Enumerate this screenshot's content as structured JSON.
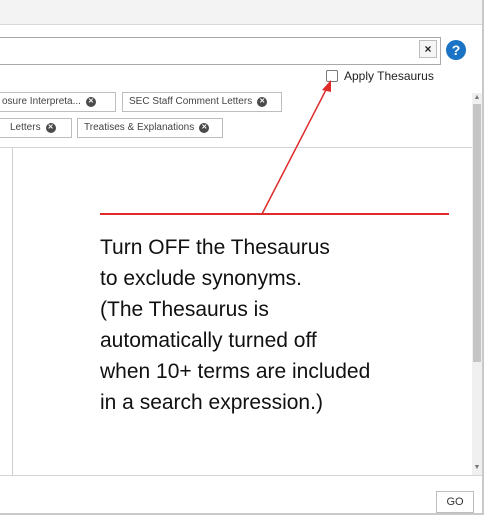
{
  "search": {
    "clear_label": "×",
    "help_label": "?",
    "apply_thesaurus_label": "Apply Thesaurus"
  },
  "filters": {
    "row1": [
      {
        "label": "osure Interpreta...",
        "remove": "✕"
      },
      {
        "label": "SEC Staff Comment Letters",
        "remove": "✕"
      }
    ],
    "row2": [
      {
        "label": "Letters",
        "remove": "✕"
      },
      {
        "label": "Treatises & Explanations",
        "remove": "✕"
      }
    ]
  },
  "annotation": {
    "lines": [
      "Turn OFF the Thesaurus",
      "to exclude synonyms.",
      "(The Thesaurus is",
      "automatically turned off",
      "when 10+ terms are included",
      "in a search expression.)"
    ],
    "color": "#e02b2b"
  },
  "footer": {
    "go_label": "GO"
  },
  "scrollbar": {
    "up_icon": "▲",
    "down_icon": "▼"
  }
}
